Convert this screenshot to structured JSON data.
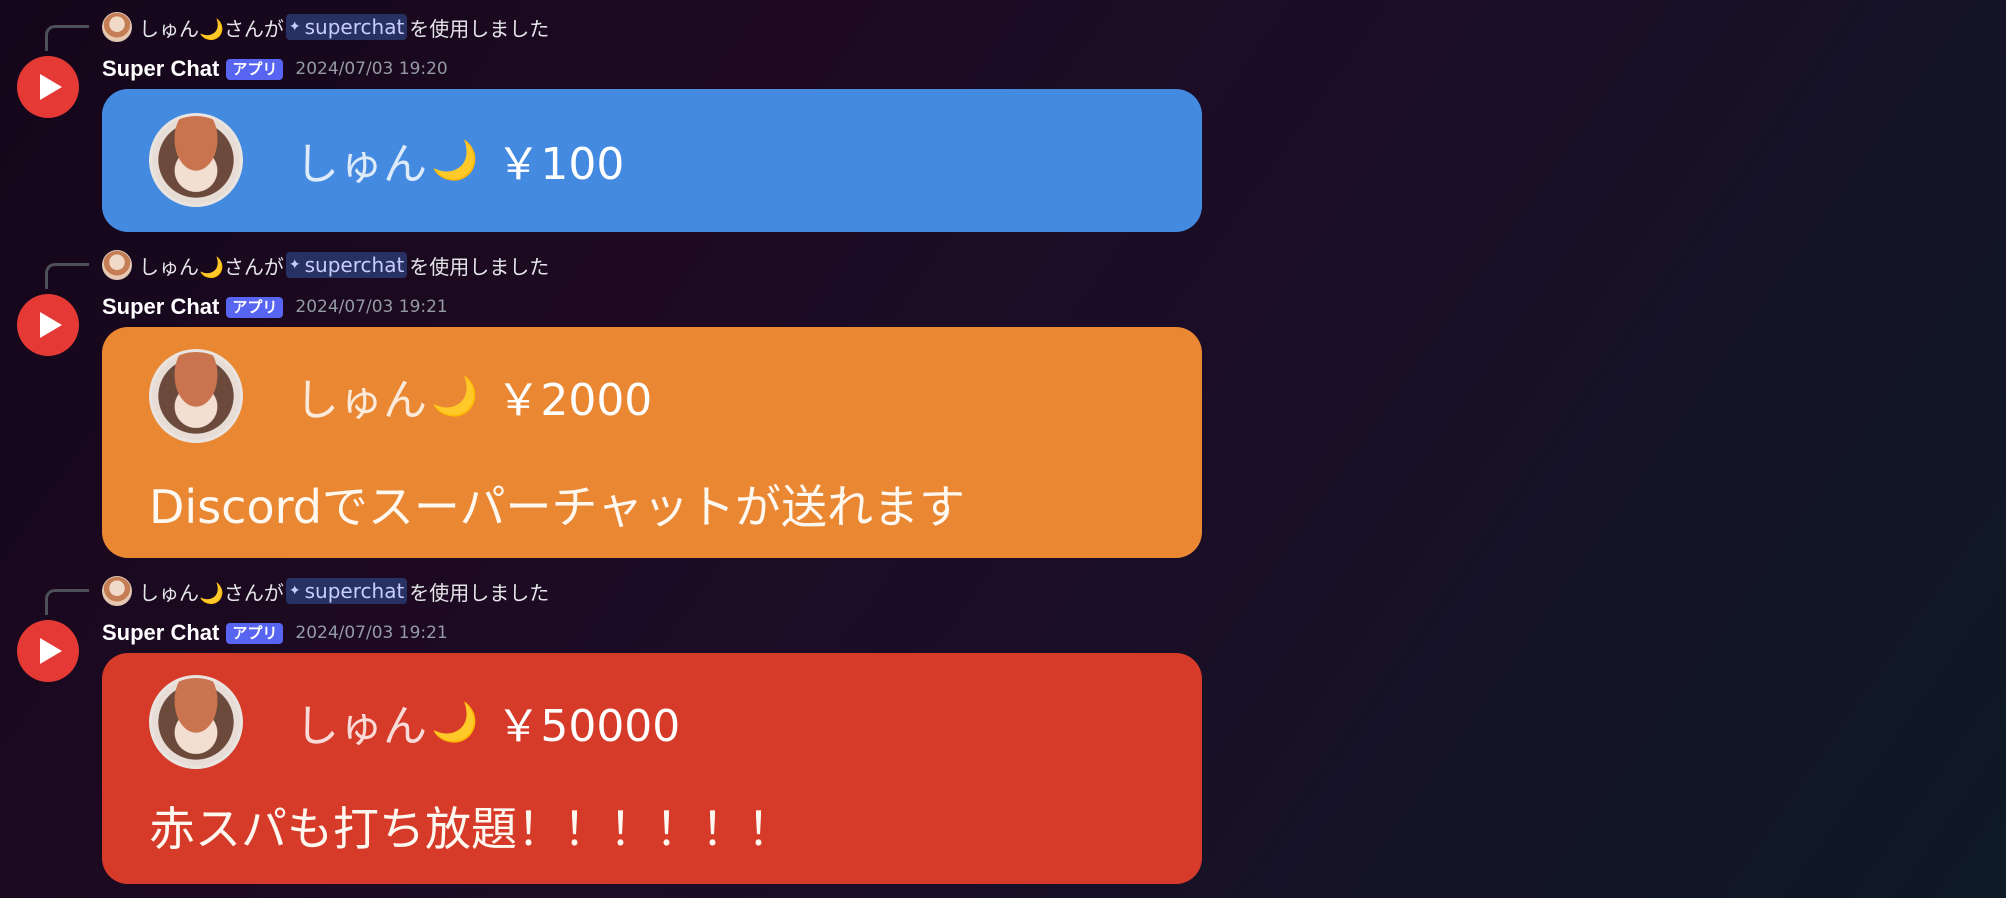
{
  "messages": [
    {
      "reply": {
        "user": "しゅん🌙",
        "suffix_a": "さんが",
        "command_icon": "✦",
        "command": "superchat",
        "suffix_b": "を使用しました"
      },
      "author": "Super Chat",
      "badge": "アプリ",
      "timestamp": "2024/07/03 19:20",
      "card": {
        "color": "#448ae0",
        "name": "しゅん",
        "moon": "🌙",
        "amount": "￥100",
        "text": ""
      }
    },
    {
      "reply": {
        "user": "しゅん🌙",
        "suffix_a": "さんが",
        "command_icon": "✦",
        "command": "superchat",
        "suffix_b": "を使用しました"
      },
      "author": "Super Chat",
      "badge": "アプリ",
      "timestamp": "2024/07/03 19:21",
      "card": {
        "color": "#e98733",
        "name": "しゅん",
        "moon": "🌙",
        "amount": "￥2000",
        "text": "Discordでスーパーチャットが送れます"
      }
    },
    {
      "reply": {
        "user": "しゅん🌙",
        "suffix_a": "さんが",
        "command_icon": "✦",
        "command": "superchat",
        "suffix_b": "を使用しました"
      },
      "author": "Super Chat",
      "badge": "アプリ",
      "timestamp": "2024/07/03 19:21",
      "card": {
        "color": "#d63a29",
        "name": "しゅん",
        "moon": "🌙",
        "amount": "￥50000",
        "text": "赤スパも打ち放題！！！！！！"
      }
    }
  ],
  "icons": {
    "app_avatar": "play-icon",
    "command": "app-command-icon"
  },
  "colors": {
    "app_avatar": "#e53935",
    "badge": "#5865f2",
    "command_bg": "#283163"
  }
}
